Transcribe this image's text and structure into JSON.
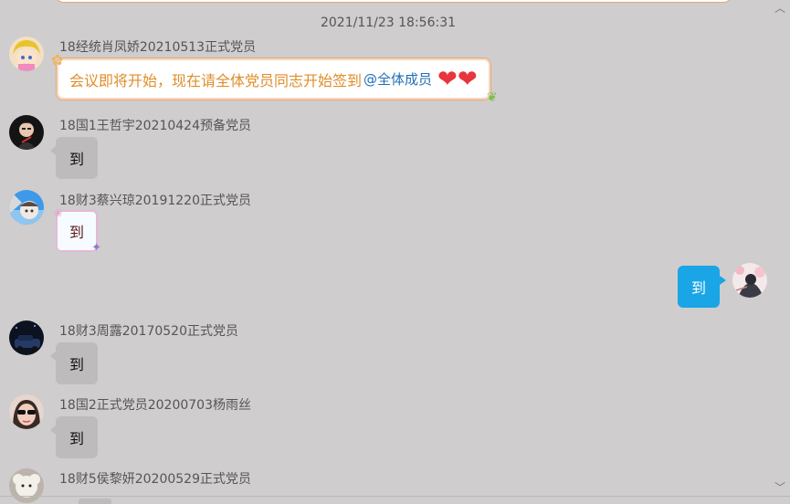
{
  "timestamp": "2021/11/23 18:56:31",
  "messages": [
    {
      "sender": "18经统肖凤娇20210513正式党员",
      "text": "会议即将开始，现在请全体党员同志开始签到",
      "mention": "@全体成员",
      "hearts": "❤❤"
    },
    {
      "sender": "18国1王哲宇20210424预备党员",
      "text": "到"
    },
    {
      "sender": "18财3蔡兴琼20191220正式党员",
      "text": "到"
    },
    {
      "sender": "18财3周露20170520正式党员",
      "text": "到"
    },
    {
      "sender": "18国2正式党员20200703杨雨丝",
      "text": "到"
    },
    {
      "sender": "18财5侯黎妍20200529正式党员",
      "text": ""
    }
  ],
  "self_message": {
    "text": "到"
  },
  "icons": {
    "scroll_up": "chevron-up-icon",
    "scroll_down": "chevron-down-icon"
  },
  "colors": {
    "background": "#cfcdcd",
    "bubble_other": "#bdbbbb",
    "bubble_self": "#1aa5e6",
    "mention": "#1f6fb6",
    "fancy_text": "#e08d2a"
  }
}
